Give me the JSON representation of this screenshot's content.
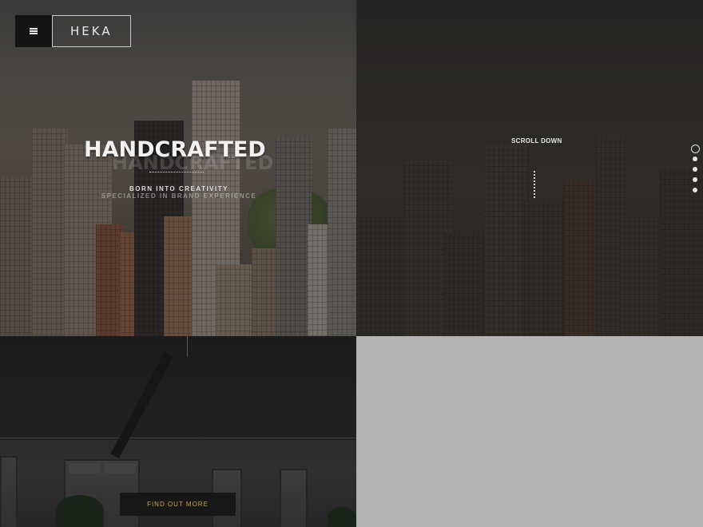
{
  "header": {
    "menu_icon": "hamburger-icon",
    "logo": "HEKA"
  },
  "hero": {
    "title": "HANDCRAFTED",
    "subtitle_1": "BORN INTO CREATIVITY",
    "subtitle_2": "SPECIALIZED IN BRAND EXPERIENCE"
  },
  "scroll": {
    "label": "SCROLL DOWN"
  },
  "side_nav": {
    "dots": 5,
    "active_index": 0
  },
  "cta": {
    "label": "FIND OUT MORE",
    "text_color": "#c9a34a"
  },
  "colors": {
    "overlay": "#1c1c1c",
    "placeholder_panel": "#b3b3b3"
  }
}
